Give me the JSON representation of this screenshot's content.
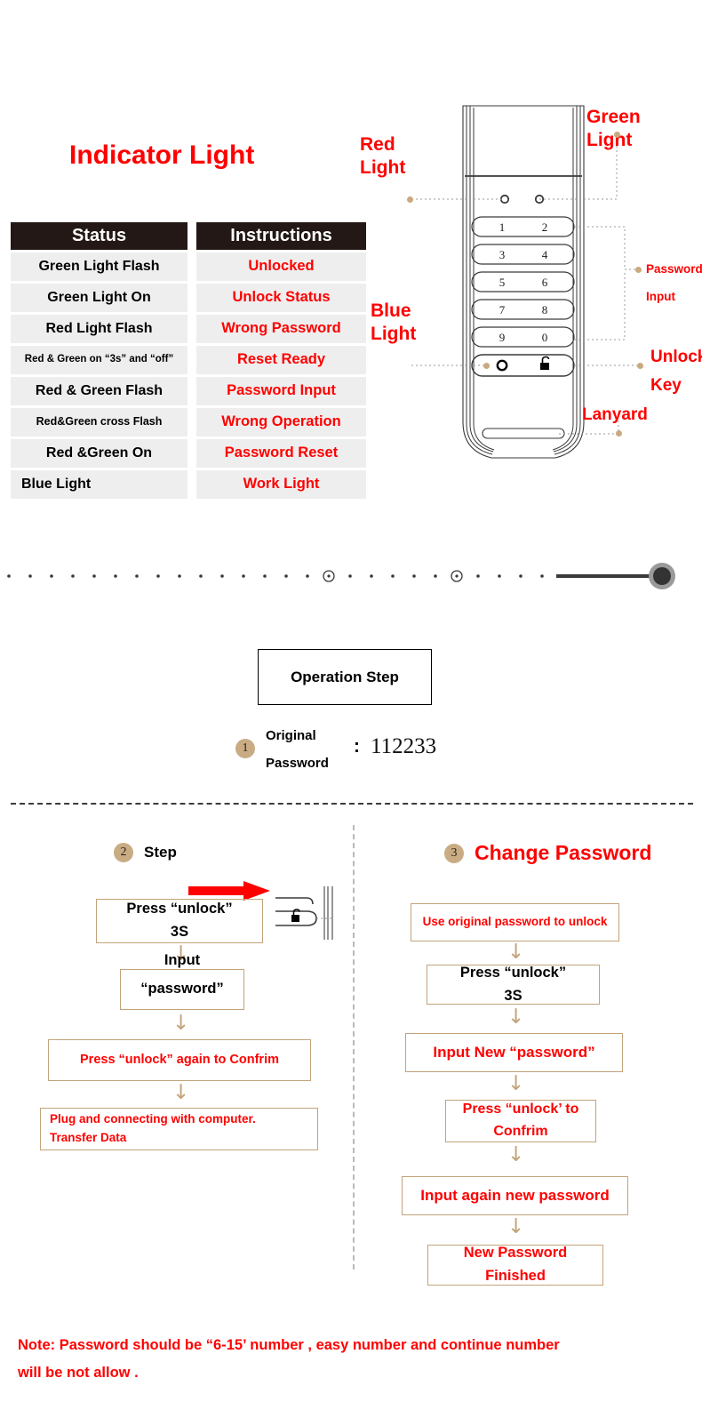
{
  "title": "Indicator Light",
  "table": {
    "headers": [
      "Status",
      "Instructions"
    ],
    "rows": [
      {
        "status": "Green Light Flash",
        "instruction": "Unlocked",
        "size": "normal"
      },
      {
        "status": "Green Light On",
        "instruction": "Unlock Status",
        "size": "normal"
      },
      {
        "status": "Red Light Flash",
        "instruction": "Wrong Password",
        "size": "normal"
      },
      {
        "status": "Red & Green on “3s” and “off”",
        "instruction": "Reset Ready",
        "size": "small"
      },
      {
        "status": "Red & Green Flash",
        "instruction": "Password Input",
        "size": "normal"
      },
      {
        "status": "Red&Green cross Flash",
        "instruction": "Wrong Operation",
        "size": "sm2"
      },
      {
        "status": "Red &Green On",
        "instruction": "Password Reset",
        "size": "normal"
      },
      {
        "status": "Blue Light",
        "instruction": "Work Light",
        "size": "normal"
      }
    ]
  },
  "device": {
    "callouts": {
      "red_light": "Red\nLight",
      "green_light": "Green\nLight",
      "blue_light": "Blue\nLight",
      "password_input_1": "Password",
      "password_input_2": "Input",
      "unlock_key_1": "Unlock",
      "unlock_key_2": "Key",
      "lanyard": "Lanyard"
    },
    "keypad": [
      "1",
      "2",
      "3",
      "4",
      "5",
      "6",
      "7",
      "8",
      "9",
      "0"
    ],
    "function_keys": [
      "power-circle-icon",
      "unlock-padlock-icon"
    ]
  },
  "operation": {
    "box_label": "Operation Step",
    "step1_number": "1",
    "step1_label_line1": "Original",
    "step1_label_line2": "Password",
    "step1_colon": ":",
    "step1_value": "112233"
  },
  "left_flow": {
    "step_number": "2",
    "heading": "Step",
    "boxes": [
      {
        "lines": [
          "Press “unlock”",
          "3S"
        ],
        "color": "black"
      },
      {
        "lines": [
          "Input",
          "“password”"
        ],
        "color": "black"
      },
      {
        "lines": [
          "Press “unlock” again to Confrim"
        ],
        "color": "red"
      },
      {
        "lines": [
          "Plug and connecting  with computer.",
          "Transfer Data"
        ],
        "color": "red"
      }
    ]
  },
  "right_flow": {
    "step_number": "3",
    "heading": "Change Password",
    "boxes": [
      {
        "lines": [
          "Use original password to unlock"
        ],
        "color": "red"
      },
      {
        "lines": [
          "Press “unlock”",
          "3S"
        ],
        "color": "black"
      },
      {
        "lines": [
          "Input New “password”"
        ],
        "color": "red"
      },
      {
        "lines": [
          "Press “unlock’ to",
          "Confrim"
        ],
        "color": "red"
      },
      {
        "lines": [
          "Input again new password"
        ],
        "color": "red"
      },
      {
        "lines": [
          "New Password",
          "Finished"
        ],
        "color": "red"
      }
    ]
  },
  "note": {
    "line1": "Note: Password should be “6-15’ number , easy number and continue number",
    "line2": "will be not allow ."
  },
  "colors": {
    "red": "#ff0000",
    "header_bg": "#231815",
    "row_bg": "#eeeeee",
    "box_border": "#c3a37a",
    "step_circle": "#c9ac84"
  }
}
